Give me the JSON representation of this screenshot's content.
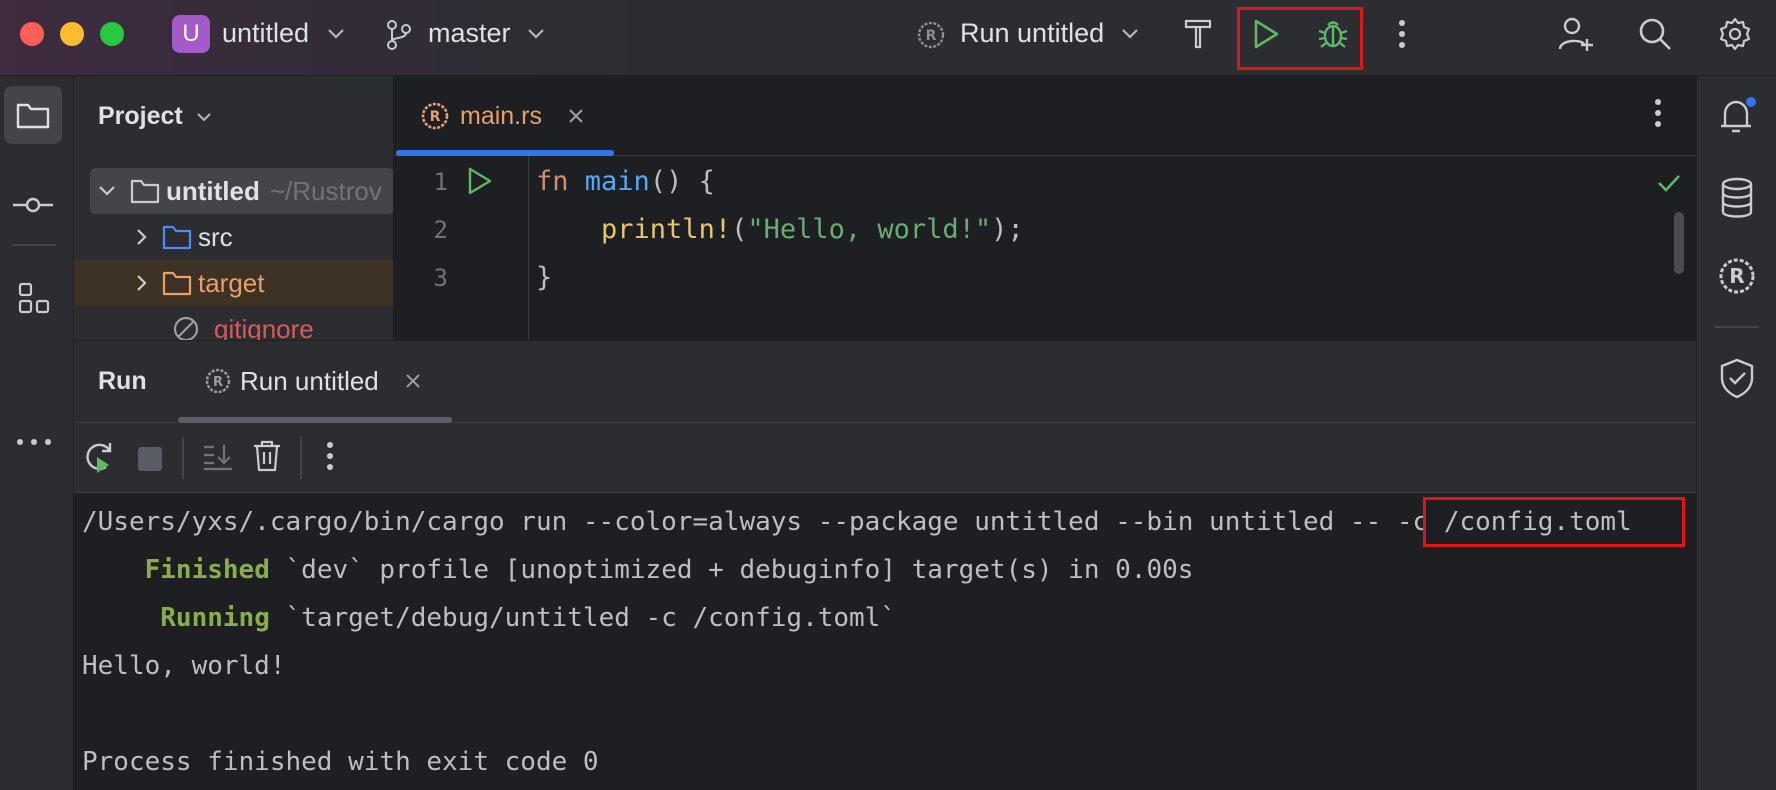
{
  "titlebar": {
    "project_initial": "U",
    "project_name": "untitled",
    "branch": "master",
    "run_config": "Run untitled"
  },
  "project_panel": {
    "title": "Project",
    "tree": [
      {
        "label": "untitled",
        "path_hint": "~/Rustrov",
        "type": "project-root",
        "expanded": true
      },
      {
        "label": "src",
        "type": "folder"
      },
      {
        "label": "target",
        "type": "excluded-folder"
      },
      {
        "label": "gitignore",
        "type": "ignore-file"
      }
    ]
  },
  "editor": {
    "tab_label": "main.rs",
    "lines": [
      {
        "no": "1",
        "parts": [
          {
            "t": "fn ",
            "c": "kw"
          },
          {
            "t": "main",
            "c": "fn"
          },
          {
            "t": "() {",
            "c": ""
          }
        ]
      },
      {
        "no": "2",
        "parts": [
          {
            "t": "    ",
            "c": ""
          },
          {
            "t": "println!",
            "c": "mac"
          },
          {
            "t": "(",
            "c": ""
          },
          {
            "t": "\"Hello, world!\"",
            "c": "str"
          },
          {
            "t": ");",
            "c": ""
          }
        ]
      },
      {
        "no": "3",
        "parts": [
          {
            "t": "}",
            "c": ""
          }
        ]
      }
    ]
  },
  "run_window": {
    "title": "Run",
    "tab_label": "Run untitled",
    "console": {
      "command_prefix": "/Users/yxs/.cargo/bin/cargo run --color=always --package untitled --bin untitled -- ",
      "command_args": "-c /config.toml",
      "finished_label": "Finished",
      "finished_text": " `dev` profile [unoptimized + debuginfo] target(s) in 0.00s",
      "running_label": "Running",
      "running_text": " `target/debug/untitled -c /config.toml`",
      "output": "Hello, world!",
      "exit": "Process finished with exit code 0"
    }
  },
  "colors": {
    "accent": "#3574f0",
    "run_green": "#5fb865",
    "highlight_red": "#e0141a",
    "project_badge": "#a55ac9"
  }
}
